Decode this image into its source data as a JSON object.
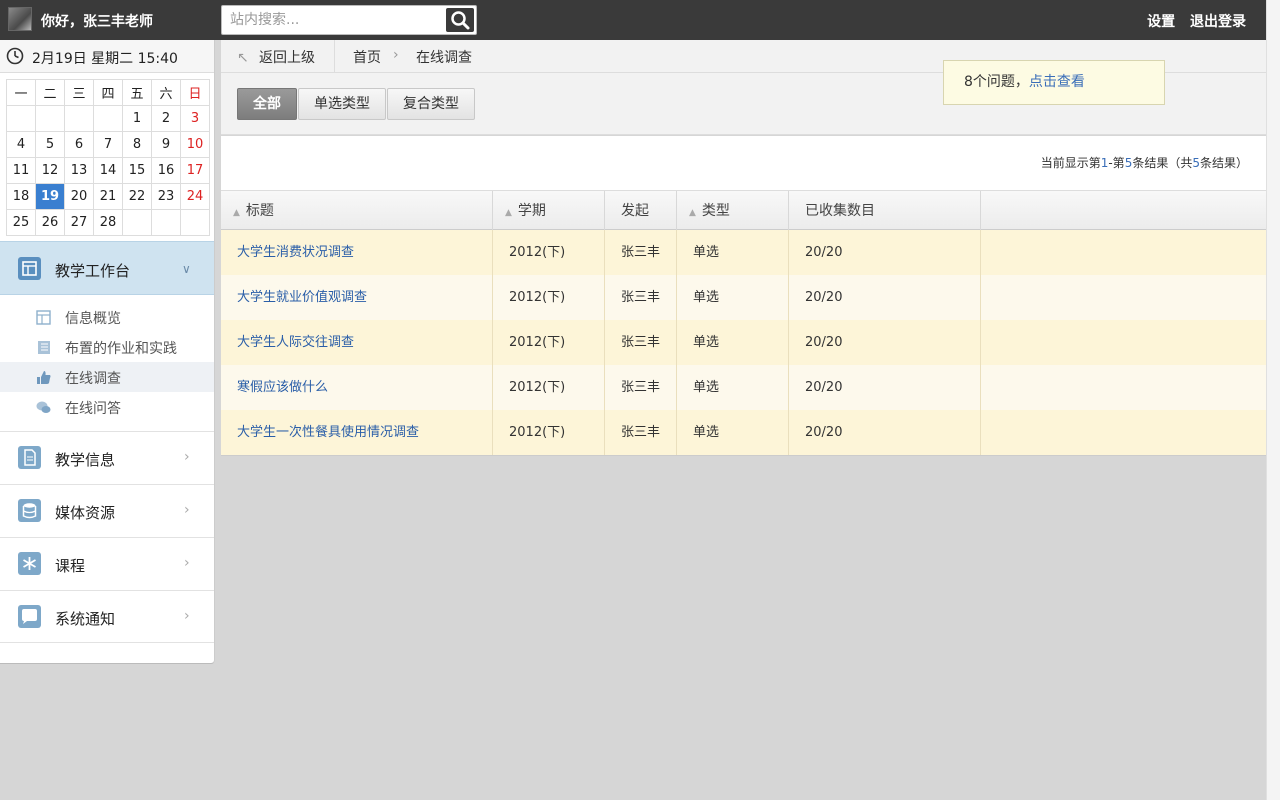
{
  "header": {
    "greeting": "你好，张三丰老师",
    "search_placeholder": "站内搜索...",
    "settings": "设置",
    "logout": "退出登录"
  },
  "sidebar": {
    "date": "2月19日 星期二 15:40",
    "weekdays": [
      "一",
      "二",
      "三",
      "四",
      "五",
      "六",
      "日"
    ],
    "calendar_rows": [
      [
        "",
        "",
        "",
        "",
        "1",
        "2",
        "3"
      ],
      [
        "4",
        "5",
        "6",
        "7",
        "8",
        "9",
        "10"
      ],
      [
        "11",
        "12",
        "13",
        "14",
        "15",
        "16",
        "17"
      ],
      [
        "18",
        "19",
        "20",
        "21",
        "22",
        "23",
        "24"
      ],
      [
        "25",
        "26",
        "27",
        "28",
        "",
        "",
        ""
      ]
    ],
    "today": "19",
    "main_nav": "教学工作台",
    "sub_items": [
      {
        "label": "信息概览",
        "icon": "dashboard-icon"
      },
      {
        "label": "布置的作业和实践",
        "icon": "notebook-icon"
      },
      {
        "label": "在线调查",
        "icon": "thumbs-up-icon"
      },
      {
        "label": "在线问答",
        "icon": "chat-icon"
      }
    ],
    "nav_items": [
      {
        "label": "教学信息",
        "icon": "document-icon"
      },
      {
        "label": "媒体资源",
        "icon": "database-icon"
      },
      {
        "label": "课程",
        "icon": "asterisk-icon"
      },
      {
        "label": "系统通知",
        "icon": "speech-bubble-icon"
      }
    ]
  },
  "breadcrumb": {
    "back": "返回上级",
    "home": "首页",
    "current": "在线调查"
  },
  "filters": [
    "全部",
    "单选类型",
    "复合类型"
  ],
  "notice": {
    "text": "8个问题，",
    "link": "点击查看"
  },
  "pager": {
    "prefix": "当前显示第",
    "from": "1",
    "dash": "-第",
    "to": "5",
    "mid": "条结果（共",
    "total": "5",
    "suffix": "条结果）"
  },
  "table": {
    "headers": [
      "标题",
      "学期",
      "发起",
      "类型",
      "已收集数目"
    ],
    "rows": [
      [
        "大学生消费状况调查",
        "2012(下)",
        "张三丰",
        "单选",
        "20/20"
      ],
      [
        "大学生就业价值观调查",
        "2012(下)",
        "张三丰",
        "单选",
        "20/20"
      ],
      [
        "大学生人际交往调查",
        "2012(下)",
        "张三丰",
        "单选",
        "20/20"
      ],
      [
        "寒假应该做什么",
        "2012(下)",
        "张三丰",
        "单选",
        "20/20"
      ],
      [
        "大学生一次性餐具使用情况调查",
        "2012(下)",
        "张三丰",
        "单选",
        "20/20"
      ]
    ]
  }
}
